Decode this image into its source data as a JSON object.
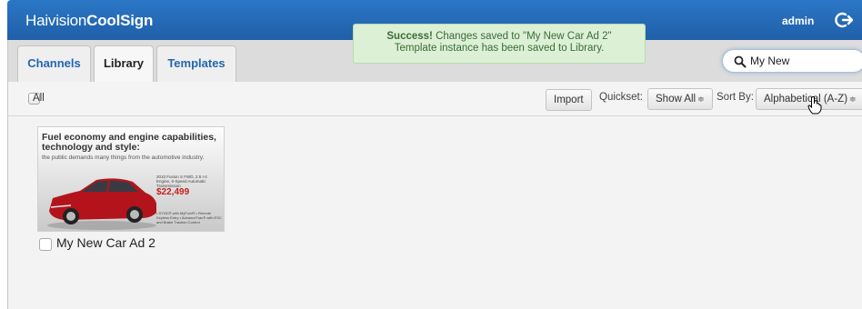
{
  "header": {
    "brand_light": "Haivision",
    "brand_bold": "CoolSign",
    "user": "admin",
    "logout_icon": "logout-arrow-icon"
  },
  "notification": {
    "bold": "Success!",
    "line1_rest": " Changes saved to \"My New Car Ad 2\"",
    "line2": "Template instance has been saved to Library."
  },
  "tabs": [
    {
      "label": "Channels",
      "active": false
    },
    {
      "label": "Library",
      "active": true
    },
    {
      "label": "Templates",
      "active": false
    }
  ],
  "search": {
    "value": "My New",
    "icon": "search-icon"
  },
  "toolbar": {
    "select_all_label": "All",
    "import_label": "Import",
    "quickset_label": "Quickset:",
    "quickset_value": "Show All",
    "sortby_label": "Sort By:",
    "sortby_value": "Alphabetical (A-Z)"
  },
  "library_items": [
    {
      "title": "My New Car Ad 2",
      "thumbnail": {
        "headline": "Fuel economy and engine capabilities, technology and style:",
        "subline": "the public demands many things from the automotive industry.",
        "spec": "2010 Fusion S FWD, 2.5 I-4 Engine, 6-Speed Automatic Transmission",
        "price": "$22,499",
        "bullets": "• SYNC® with MyFord® • Remote Keyless Entry • AdvanceTrac® with ESC and Brake Traction Control"
      }
    }
  ],
  "colors": {
    "header_blue": "#1f5fa8",
    "tab_link_blue": "#2266b0",
    "success_bg": "#dcf0d6",
    "price_red": "#c42020",
    "car_red": "#b3141b"
  }
}
